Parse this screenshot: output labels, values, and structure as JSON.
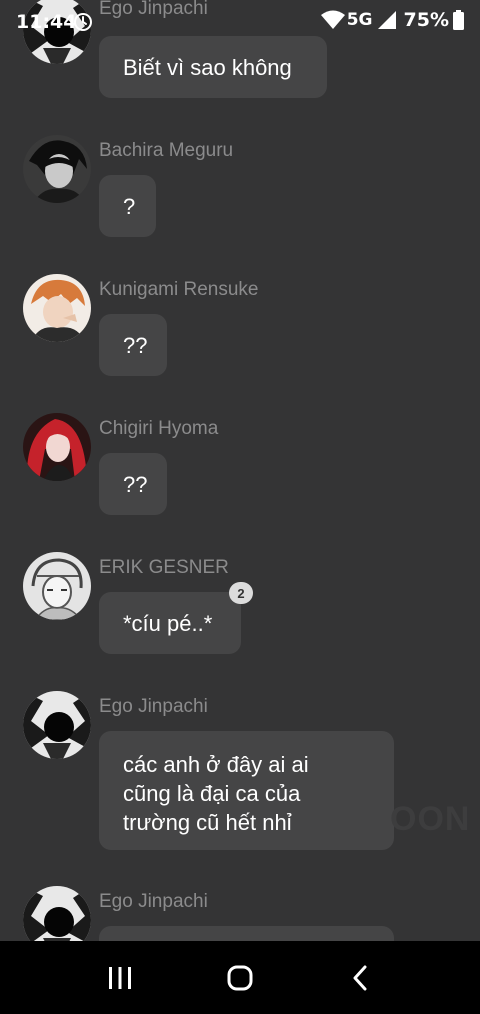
{
  "status_bar": {
    "time": "11:44",
    "network": "5G",
    "battery": "75%"
  },
  "messages": [
    {
      "sender": "Ego Jinpachi",
      "text": "Biết vì sao không",
      "avatar": "ego-avatar"
    },
    {
      "sender": "Bachira Meguru",
      "text": "?",
      "avatar": "bachira-avatar"
    },
    {
      "sender": "Kunigami Rensuke",
      "text": "??",
      "avatar": "kunigami-avatar"
    },
    {
      "sender": "Chigiri Hyoma",
      "text": "??",
      "avatar": "chigiri-avatar"
    },
    {
      "sender": "ERIK GESNER",
      "text": "*cíu pé..*",
      "avatar": "gesner-avatar",
      "reaction_count": "2"
    },
    {
      "sender": "Ego Jinpachi",
      "text": "các anh ở đây ai ai\ncũng là đại ca của\ntrường cũ hết nhỉ",
      "avatar": "ego-avatar"
    },
    {
      "sender": "Ego Jinpachi",
      "text": "",
      "avatar": "ego-avatar"
    }
  ],
  "watermark": "OON",
  "nav": {
    "recents": "recents-icon",
    "home": "home-icon",
    "back": "back-icon"
  }
}
